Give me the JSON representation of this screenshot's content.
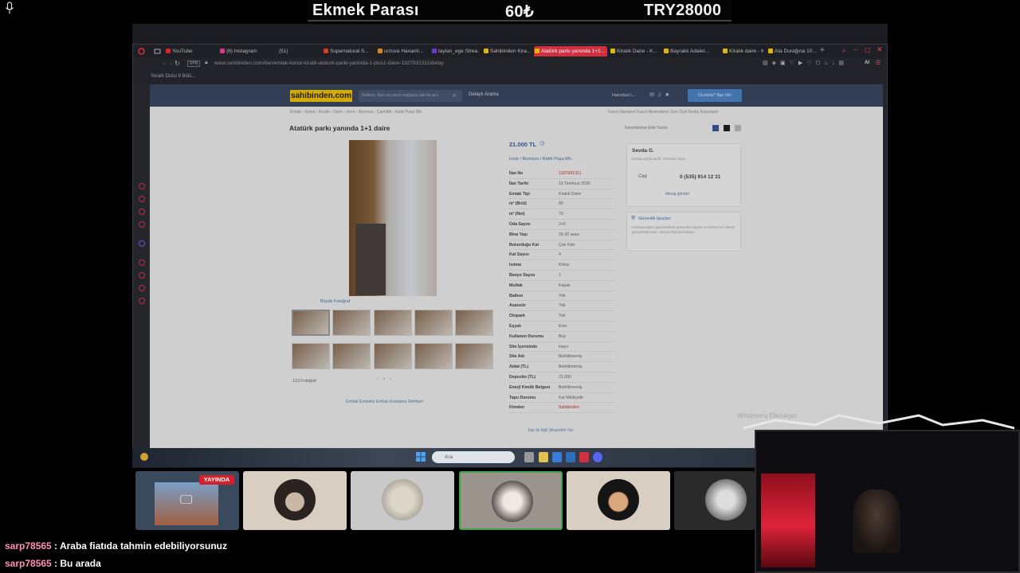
{
  "overlay": {
    "stat_title": "Ekmek Parası",
    "stat_price": "60₺",
    "stat_total": "TRY28000"
  },
  "browser": {
    "tabs": [
      {
        "label": "YouTube",
        "color": "#e02020"
      },
      {
        "label": "(6) Instagram",
        "color": "#d0408a"
      },
      {
        "label": "(51)",
        "color": "#222"
      },
      {
        "label": "Supernatural S...",
        "color": "#d04020"
      },
      {
        "label": "urzuva Hanami...",
        "color": "#e08020"
      },
      {
        "label": "taylan_ege Strea...",
        "color": "#6a3ad0"
      },
      {
        "label": "Sahibinden Kira...",
        "color": "#e0b800"
      },
      {
        "label": "Atatürk parkı yanında 1+1...",
        "color": "#e0b800"
      },
      {
        "label": "Kiralık Daire - K...",
        "color": "#e0b800"
      },
      {
        "label": "Bayraklı Adalet...",
        "color": "#e0b800"
      },
      {
        "label": "Kiralık daire - K...",
        "color": "#e0b800"
      },
      {
        "label": "Ata Durağına 10...",
        "color": "#e0b800"
      }
    ],
    "url": "www.sahibinden.com/ilan/emlak-konut-kiralik-ataturk-parki-yaninda-1-plus1-daire-1327931311/detay",
    "bookmark": "Yeraltı Dizisi 9 Bölü..."
  },
  "site": {
    "logo": "sahibinden.com",
    "search_placeholder": "Kelime, ilan no veya mağaza adı ile ara",
    "advanced_search": "Detaylı Arama",
    "user_menu": "Hannibal L...",
    "post_ad": "Ücretsiz* İlan Ver",
    "breadcrumb": "Emlak  ›  Konut  ›  Kiralık  ›  Daire  ›  İzmir  ›  Bornova  ›  Çamdibi  ›  Rafet Paşa Mh.",
    "right_links": "Favori İlanlarım    Favori Aramalarım    Size Özel İlanlar    Karşılaştır",
    "title": "Atatürk parkı yanında 1+1 daire",
    "fav_links": "Favorilerime Ekle        Yazdır",
    "big_photo_link": "Büyük Fotoğraf",
    "photo_count": "1/13 Fotoğraf",
    "bottom_links": "Emlak Endeksi      Emlak Kiralama Rehberi",
    "price": "21.000 TL",
    "location": "İzmir  /  Bornova  /  Rafet Paşa Mh.",
    "details": [
      {
        "k": "İlan No",
        "v": "1327931311"
      },
      {
        "k": "İlan Tarihi",
        "v": "13 Temmuz 2026"
      },
      {
        "k": "Emlak Tipi",
        "v": "Kiralık Daire"
      },
      {
        "k": "m² (Brüt)",
        "v": "80"
      },
      {
        "k": "m² (Net)",
        "v": "70"
      },
      {
        "k": "Oda Sayısı",
        "v": "2+0"
      },
      {
        "k": "Bina Yaşı",
        "v": "26-30 arası"
      },
      {
        "k": "Bulunduğu Kat",
        "v": "Çatı Katı"
      },
      {
        "k": "Kat Sayısı",
        "v": "4"
      },
      {
        "k": "Isıtma",
        "v": "Klima"
      },
      {
        "k": "Banyo Sayısı",
        "v": "1"
      },
      {
        "k": "Mutfak",
        "v": "Kapalı"
      },
      {
        "k": "Balkon",
        "v": "Yok"
      },
      {
        "k": "Asansör",
        "v": "Yok"
      },
      {
        "k": "Otopark",
        "v": "Yok"
      },
      {
        "k": "Eşyalı",
        "v": "Evet"
      },
      {
        "k": "Kullanım Durumu",
        "v": "Boş"
      },
      {
        "k": "Site İçerisinde",
        "v": "Hayır"
      },
      {
        "k": "Site Adı",
        "v": "Belirtilmemiş"
      },
      {
        "k": "Aidat (TL)",
        "v": "Belirtilmemiş"
      },
      {
        "k": "Depozito (TL)",
        "v": "21.000"
      },
      {
        "k": "Enerji Kimlik Belgesi",
        "v": "Belirtilmemiş"
      },
      {
        "k": "Tapu Durumu",
        "v": "Kat Mülkiyetli"
      },
      {
        "k": "Kimden",
        "v": "Sahibinden"
      }
    ],
    "report_link": "İlan ile İlgili Şikayetim Var",
    "seller_name": "Sevda G.",
    "seller_since": "Hesap açma tarihi: Temmuz 2024",
    "phone_label": "Cep",
    "phone_value": "0 (535) 914 12 31",
    "message_link": "Mesaj gönder",
    "safety_title": "Güvenlik İpuçları",
    "safety_text": "Kiralayacağınız gayrimenkulü görmeden kapora ve benzeri bir ödeme gerçekleştirmeyin. Detaylı bilgi için tıklayın.",
    "windows_watermark": "Windows'u Etkinleştir"
  },
  "taskbar": {
    "search_placeholder": "Ara"
  },
  "stream": {
    "live_badge": "YAYINDA"
  },
  "chat": [
    {
      "user": "sarp78565",
      "message": "Araba fiatıda tahmin edebiliyorsunuz"
    },
    {
      "user": "sarp78565",
      "message": "Bu arada"
    }
  ]
}
